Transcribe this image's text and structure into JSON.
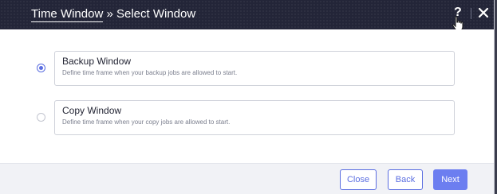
{
  "header": {
    "breadcrumb_link": "Time Window",
    "separator": " » ",
    "current": "Select Window",
    "help_label": "?",
    "help_icon": "question-mark-icon",
    "close_icon": "close-x-icon"
  },
  "options": [
    {
      "title": "Backup Window",
      "description": "Define time frame when your backup jobs are allowed to start.",
      "selected": true
    },
    {
      "title": "Copy Window",
      "description": "Define time frame when your copy jobs are allowed to start.",
      "selected": false
    }
  ],
  "footer": {
    "close_label": "Close",
    "back_label": "Back",
    "next_label": "Next"
  },
  "colors": {
    "header_bg": "#232538",
    "accent": "#5b6ee1",
    "primary_button": "#6c7ef0"
  }
}
